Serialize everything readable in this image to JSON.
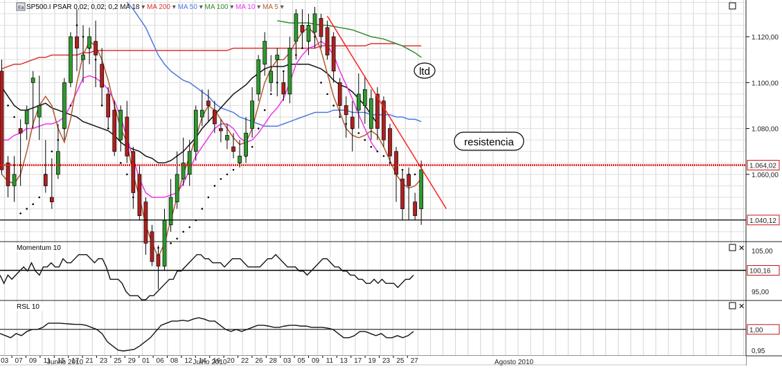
{
  "chart_data": {
    "type": "candlestick",
    "header": {
      "icon": "chart-icon",
      "symbol": "SP500.I",
      "psar_label": "PSAR 0,02; 0,02; 0,2",
      "indicators": [
        {
          "label": "MA 18",
          "color": "#111111"
        },
        {
          "label": "MA 200",
          "color": "#e03030"
        },
        {
          "label": "MA 50",
          "color": "#4a78e0"
        },
        {
          "label": "MA 100",
          "color": "#2f8a2f"
        },
        {
          "label": "MA 10",
          "color": "#ee33ee"
        },
        {
          "label": "MA 5",
          "color": "#b05a30"
        }
      ]
    },
    "annotations": {
      "ltd": "ltd",
      "resistencia": "resistencia"
    },
    "price_axis": {
      "ticks": [
        "1.120,00",
        "1.100,00",
        "1.080,00",
        "1.060,00"
      ],
      "ylim": [
        1031,
        1136
      ],
      "resistance_level": "1.064,02",
      "support_level": "1.040,12",
      "resistance_value": 1064.02,
      "support_value": 1040.12
    },
    "day_labels": [
      "03",
      "07",
      "09",
      "11",
      "15",
      "17",
      "21",
      "23",
      "25",
      "29",
      "01",
      "06",
      "08",
      "12",
      "14",
      "16",
      "20",
      "22",
      "26",
      "28",
      "03",
      "05",
      "09",
      "11",
      "13",
      "17",
      "19",
      "23",
      "25",
      "27"
    ],
    "month_labels": [
      "Junho 2010",
      "Julho 2010",
      "Agosto 2010"
    ],
    "candles": {
      "open": [
        1105,
        1065,
        1055,
        1080,
        1082,
        1100,
        1085,
        1060,
        1050,
        1060,
        1080,
        1100,
        1120,
        1110,
        1115,
        1118,
        1108,
        1095,
        1088,
        1075,
        1085,
        1070,
        1060,
        1048,
        1035,
        1025,
        1020,
        1038,
        1048,
        1058,
        1060,
        1070,
        1085,
        1092,
        1088,
        1080,
        1075,
        1072,
        1065,
        1068,
        1080,
        1095,
        1108,
        1100,
        1110,
        1100,
        1095,
        1118,
        1125,
        1118,
        1122,
        1128,
        1124,
        1120,
        1100,
        1090,
        1085,
        1088,
        1090,
        1080,
        1095,
        1092,
        1080,
        1070,
        1058,
        1060,
        1048,
        1045
      ],
      "high": [
        1110,
        1068,
        1068,
        1084,
        1090,
        1105,
        1103,
        1075,
        1067,
        1082,
        1102,
        1122,
        1132,
        1125,
        1124,
        1127,
        1115,
        1098,
        1092,
        1090,
        1092,
        1072,
        1064,
        1050,
        1038,
        1029,
        1045,
        1058,
        1070,
        1076,
        1075,
        1090,
        1097,
        1097,
        1092,
        1084,
        1082,
        1078,
        1075,
        1085,
        1098,
        1112,
        1122,
        1112,
        1115,
        1105,
        1120,
        1132,
        1132,
        1130,
        1133,
        1130,
        1127,
        1122,
        1102,
        1094,
        1092,
        1104,
        1103,
        1097,
        1098,
        1094,
        1082,
        1072,
        1062,
        1063,
        1052,
        1066
      ],
      "low": [
        1060,
        1050,
        1048,
        1055,
        1075,
        1080,
        1075,
        1052,
        1045,
        1058,
        1075,
        1098,
        1105,
        1100,
        1108,
        1098,
        1090,
        1080,
        1068,
        1070,
        1065,
        1045,
        1040,
        1025,
        1020,
        1010,
        1018,
        1035,
        1045,
        1055,
        1055,
        1066,
        1081,
        1083,
        1078,
        1074,
        1071,
        1067,
        1063,
        1065,
        1076,
        1092,
        1103,
        1096,
        1094,
        1092,
        1091,
        1110,
        1115,
        1112,
        1115,
        1115,
        1110,
        1100,
        1085,
        1076,
        1070,
        1080,
        1082,
        1075,
        1075,
        1072,
        1065,
        1048,
        1040,
        1040,
        1040,
        1038
      ],
      "close": [
        1062,
        1055,
        1060,
        1078,
        1088,
        1102,
        1090,
        1055,
        1048,
        1070,
        1100,
        1120,
        1115,
        1112,
        1120,
        1112,
        1098,
        1085,
        1070,
        1088,
        1068,
        1052,
        1042,
        1030,
        1022,
        1020,
        1040,
        1050,
        1060,
        1065,
        1070,
        1088,
        1088,
        1090,
        1082,
        1079,
        1077,
        1070,
        1068,
        1078,
        1092,
        1110,
        1118,
        1105,
        1112,
        1095,
        1115,
        1130,
        1122,
        1125,
        1130,
        1120,
        1112,
        1105,
        1090,
        1086,
        1080,
        1095,
        1097,
        1093,
        1080,
        1075,
        1068,
        1060,
        1045,
        1055,
        1042,
        1062
      ]
    },
    "psar": [
      1100,
      1090,
      1085,
      1043,
      1045,
      1047,
      1050,
      1060,
      1070,
      1075,
      1080,
      1090,
      1125,
      1120,
      1115,
      1110,
      1090,
      1080,
      1075,
      1065,
      1060,
      1050,
      1045,
      1040,
      1030,
      1028,
      1028,
      1030,
      1032,
      1035,
      1037,
      1040,
      1045,
      1050,
      1055,
      1058,
      1060,
      1062,
      1065,
      1068,
      1072,
      1080,
      1088,
      1095,
      1100,
      1105,
      1108,
      1112,
      1115,
      1118,
      1120,
      1100,
      1095,
      1090,
      1085,
      1082,
      1080,
      1078,
      1075,
      1072,
      1070,
      1068,
      1065,
      1063,
      1062,
      1060,
      1060,
      1060
    ],
    "ma_lines": {
      "ma200": [
        1106,
        1107,
        1108,
        1108,
        1109,
        1110,
        1111,
        1111,
        1112,
        1112,
        1112,
        1112,
        1112,
        1113,
        1113,
        1114,
        1114,
        1114,
        1114,
        1114,
        1114,
        1114,
        1114,
        1114,
        1114,
        1114,
        1114,
        1114,
        1114,
        1114,
        1114,
        1114,
        1114,
        1114,
        1114,
        1114,
        1114,
        1115,
        1115,
        1115,
        1115,
        1115,
        1115,
        1115,
        1115,
        1115,
        1115,
        1115,
        1115,
        1115,
        1115,
        1116,
        1116,
        1116,
        1116,
        1116,
        1116,
        1116,
        1116,
        1117,
        1117,
        1117,
        1117,
        1117,
        1116,
        1116,
        1116,
        1116
      ],
      "ma100": [
        null,
        null,
        null,
        null,
        null,
        null,
        null,
        null,
        null,
        null,
        null,
        null,
        null,
        null,
        null,
        null,
        null,
        null,
        null,
        null,
        null,
        null,
        null,
        null,
        null,
        null,
        null,
        null,
        null,
        null,
        null,
        null,
        null,
        null,
        null,
        null,
        null,
        null,
        null,
        null,
        null,
        null,
        null,
        null,
        1127,
        1126.5,
        1126,
        1126,
        1126,
        1126,
        1125.5,
        1125,
        1125,
        1124.5,
        1124,
        1123.5,
        1123,
        1122,
        1121,
        1120,
        1119.5,
        1119,
        1118,
        1117,
        1116,
        1114.5,
        1113,
        1111
      ],
      "ma50": [
        null,
        null,
        null,
        null,
        null,
        null,
        null,
        null,
        null,
        null,
        null,
        null,
        null,
        null,
        null,
        null,
        null,
        null,
        null,
        null,
        1135,
        1132,
        1128,
        1124,
        1118,
        1112,
        1108,
        1105,
        1103,
        1101,
        1100,
        1098,
        1096,
        1094,
        1091,
        1089,
        1088,
        1087,
        1085,
        1084,
        1083,
        1082,
        1081,
        1081,
        1081,
        1082,
        1083,
        1084,
        1085,
        1086,
        1087,
        1087,
        1087,
        1088,
        1088,
        1088,
        1087,
        1087,
        1087,
        1086,
        1086,
        1086,
        1086,
        1085,
        1085,
        1084,
        1084,
        1083
      ],
      "ma18": [
        1098,
        1094,
        1090,
        1088,
        1088,
        1089,
        1090,
        1091,
        1089,
        1088,
        1087,
        1086,
        1085,
        1083,
        1082,
        1081,
        1080,
        1079,
        1077,
        1074,
        1072,
        1071,
        1070,
        1068,
        1067,
        1065,
        1065,
        1066,
        1068,
        1070,
        1073,
        1076,
        1080,
        1083,
        1086,
        1089,
        1092,
        1095,
        1097,
        1099,
        1102,
        1104,
        1106,
        1107,
        1107,
        1107,
        1108,
        1108,
        1108,
        1108,
        1107,
        1106,
        1104,
        1101,
        1099,
        1098,
        1096,
        1093,
        1090,
        1086,
        1082
      ],
      "ma10": [
        1075,
        1075,
        1077,
        1078,
        1080,
        1080,
        1081,
        1082,
        1082,
        1083,
        1085,
        1090,
        1096,
        1102,
        1103,
        1102,
        1100,
        1097,
        1092,
        1085,
        1076,
        1067,
        1058,
        1052,
        1050,
        1050,
        1050,
        1051,
        1052,
        1056,
        1062,
        1068,
        1072,
        1076,
        1080,
        1082,
        1082,
        1080,
        1076,
        1074,
        1075,
        1078,
        1082,
        1086,
        1089,
        1093,
        1100,
        1108,
        1112,
        1115,
        1116,
        1118,
        1116,
        1112,
        1105,
        1099,
        1093,
        1086,
        1080,
        1074,
        1070
      ],
      "ma5": [
        1060,
        1057,
        1056,
        1060,
        1070,
        1082,
        1090,
        1094,
        1090,
        1080,
        1074,
        1084,
        1100,
        1112,
        1118,
        1116,
        1110,
        1101,
        1090,
        1080,
        1074,
        1060,
        1050,
        1038,
        1030,
        1024,
        1030,
        1040,
        1050,
        1060,
        1068,
        1076,
        1085,
        1090,
        1088,
        1084,
        1080,
        1076,
        1073,
        1074,
        1080,
        1090,
        1100,
        1106,
        1110,
        1110,
        1113,
        1118,
        1122,
        1124,
        1121,
        1114,
        1104,
        1094,
        1087,
        1080,
        1077,
        1076,
        1077,
        1079,
        1077,
        1072,
        1066,
        1060,
        1056,
        1054,
        1055,
        1058
      ]
    },
    "trendline": {
      "x": [
        52,
        71
      ],
      "y": [
        1129,
        1045
      ]
    },
    "momentum": {
      "title": "Momentum 10",
      "ticks": [
        "105,00",
        "95,00"
      ],
      "level": "100,16",
      "ylim": [
        93,
        107
      ],
      "level_value": 100.16,
      "values": [
        99,
        97,
        99,
        98,
        99,
        100,
        101,
        100,
        102,
        100,
        99,
        101,
        101,
        102,
        101,
        101,
        103,
        102,
        102,
        103,
        104,
        104,
        104,
        103,
        102,
        103,
        103,
        101,
        98,
        98,
        98,
        97,
        95,
        94,
        94,
        94,
        93,
        93,
        94,
        94,
        95,
        96,
        97,
        98,
        98,
        100,
        100,
        101,
        102,
        103,
        104,
        104,
        103,
        103,
        102,
        102,
        102,
        101,
        102,
        103,
        103,
        103,
        102,
        101,
        101,
        101,
        101,
        102,
        103,
        103,
        104,
        103,
        102,
        101,
        101,
        101,
        100,
        100,
        99,
        100,
        101,
        102,
        103,
        103,
        102,
        101,
        101,
        100,
        100,
        99,
        99,
        98,
        98,
        97,
        97,
        98,
        97,
        98,
        97,
        97,
        97,
        96,
        97,
        98,
        98,
        99
      ]
    },
    "rsl": {
      "title": "RSL 10",
      "ticks": [
        "1,00",
        "0,95"
      ],
      "ylim": [
        0.938,
        1.068
      ],
      "level_value": 1.0,
      "values": [
        0.99,
        0.985,
        0.98,
        0.99,
        0.985,
        0.995,
        1.0,
        1.0,
        1.005,
        1.015,
        1.015,
        1.015,
        1.014,
        1.013,
        1.012,
        1.012,
        1.01,
        1.005,
        1.0,
        0.99,
        0.97,
        0.96,
        0.95,
        0.948,
        0.95,
        0.952,
        0.96,
        0.97,
        0.98,
        0.995,
        1.01,
        1.015,
        1.02,
        1.02,
        1.022,
        1.02,
        1.025,
        1.028,
        1.025,
        1.02,
        1.02,
        1.01,
        1.0,
        0.995,
        1.0,
        0.995,
        1.0,
        1.005,
        1.01,
        1.01,
        1.008,
        1.005,
        1.005,
        1.008,
        1.01,
        1.01,
        1.008,
        1.008,
        1.005,
        1.005,
        1.005,
        1.003,
        1.0,
        0.99,
        0.98,
        0.98,
        0.985,
        0.995,
        0.995,
        0.99,
        0.985,
        0.99,
        0.98,
        0.98,
        0.985,
        0.98,
        0.985,
        0.995
      ]
    }
  }
}
